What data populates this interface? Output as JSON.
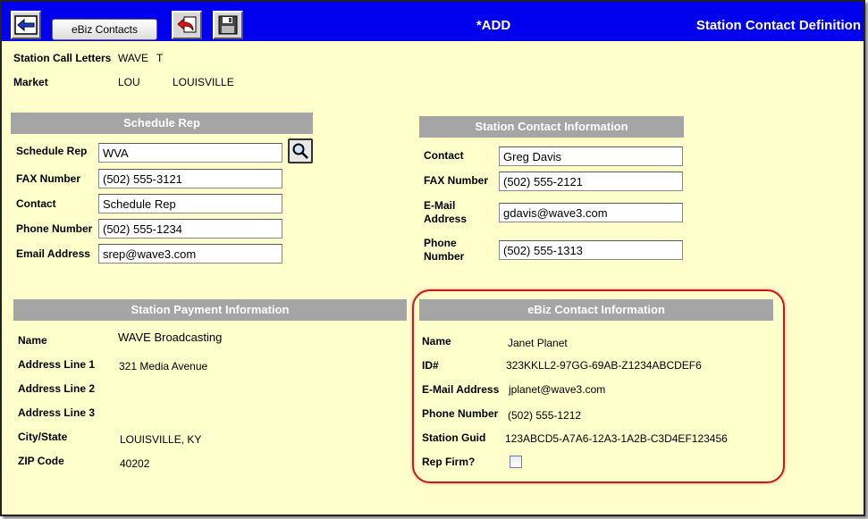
{
  "toolbar": {
    "ebiz_contacts_label": "eBiz Contacts",
    "mode": "*ADD",
    "title": "Station Contact Definition",
    "icons": [
      "back-arrow-icon",
      "undo-icon",
      "save-icon"
    ],
    "color": "#0000ee"
  },
  "station": {
    "call_letters_label": "Station Call Letters",
    "call_letters": "WAVE",
    "call_letters_suffix": "T",
    "market_label": "Market",
    "market_code": "LOU",
    "market_name": "LOUISVILLE"
  },
  "schedule_rep": {
    "header": "Schedule Rep",
    "rep_label": "Schedule Rep",
    "rep": "WVA",
    "fax_label": "FAX Number",
    "fax": "(502) 555-3121",
    "contact_label": "Contact",
    "contact": "Schedule Rep",
    "phone_label": "Phone Number",
    "phone": "(502) 555-1234",
    "email_label": "Email Address",
    "email": "srep@wave3.com"
  },
  "station_contact": {
    "header": "Station Contact Information",
    "contact_label": "Contact",
    "contact": "Greg Davis",
    "fax_label": "FAX Number",
    "fax": "(502) 555-2121",
    "email_label_1": "E-Mail",
    "email_label_2": "Address",
    "email": "gdavis@wave3.com",
    "phone_label_1": "Phone",
    "phone_label_2": "Number",
    "phone": "(502) 555-1313"
  },
  "payment": {
    "header": "Station Payment Information",
    "name_label": "Name",
    "name": "WAVE Broadcasting",
    "address1_label": "Address Line 1",
    "address1": "321 Media Avenue",
    "address2_label": "Address Line 2",
    "address3_label": "Address Line 3",
    "city_state_label": "City/State",
    "city_state": "LOUISVILLE, KY",
    "zip_label": "ZIP Code",
    "zip": "40202"
  },
  "ebiz": {
    "header": "eBiz Contact Information",
    "name_label": "Name",
    "name": "Janet  Planet",
    "id_label": "ID#",
    "id": "323KKLL2-97GG-69AB-Z1234ABCDEF6",
    "email_label": "E-Mail Address",
    "email": "jplanet@wave3.com",
    "phone_label": "Phone Number",
    "phone": "(502) 555-1212",
    "guid_label": "Station Guid",
    "guid": "123ABCD5-A7A6-12A3-1A2B-C3D4EF123456",
    "rep_firm_label": "Rep Firm?",
    "rep_firm": false,
    "highlight_color": "#c61a1a"
  }
}
